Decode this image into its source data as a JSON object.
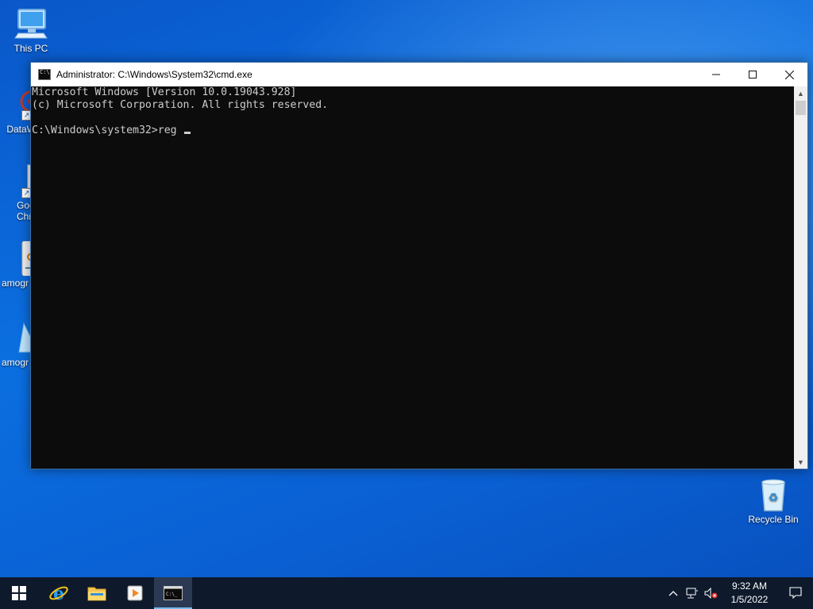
{
  "desktop": {
    "icons": [
      {
        "label": "This PC",
        "icon": "computer-icon"
      },
      {
        "label": "DataW",
        "icon": "datawin-icon"
      },
      {
        "label": "Goo\nChro",
        "icon": "chrome-icon"
      },
      {
        "label": "amogr",
        "icon": "java-icon"
      },
      {
        "label": "amogr",
        "icon": "app-icon"
      },
      {
        "label": "Recycle Bin",
        "icon": "recycle-bin-icon"
      }
    ]
  },
  "window": {
    "title": "Administrator: C:\\Windows\\System32\\cmd.exe",
    "controls": {
      "minimize": "—",
      "maximize": "☐",
      "close": "✕"
    }
  },
  "console": {
    "lines": [
      "Microsoft Windows [Version 10.0.19043.928]",
      "(c) Microsoft Corporation. All rights reserved.",
      ""
    ],
    "prompt": "C:\\Windows\\system32>",
    "input": "reg "
  },
  "taskbar": {
    "apps": [
      {
        "name": "start-button",
        "icon": "windows-logo-icon"
      },
      {
        "name": "internet-explorer",
        "icon": "internet-explorer-icon"
      },
      {
        "name": "file-explorer",
        "icon": "folder-icon"
      },
      {
        "name": "media-player",
        "icon": "media-player-icon"
      },
      {
        "name": "command-prompt",
        "icon": "cmd-icon",
        "active": true
      }
    ],
    "tray": {
      "time": "9:32 AM",
      "date": "1/5/2022",
      "icons": [
        "chevron-up-icon",
        "network-icon",
        "volume-muted-icon",
        "notification-icon"
      ]
    }
  },
  "colors": {
    "desktop": "#0b6fe0",
    "console_bg": "#0c0c0c",
    "console_fg": "#cccccc",
    "taskbar": "#0e1a2b"
  }
}
